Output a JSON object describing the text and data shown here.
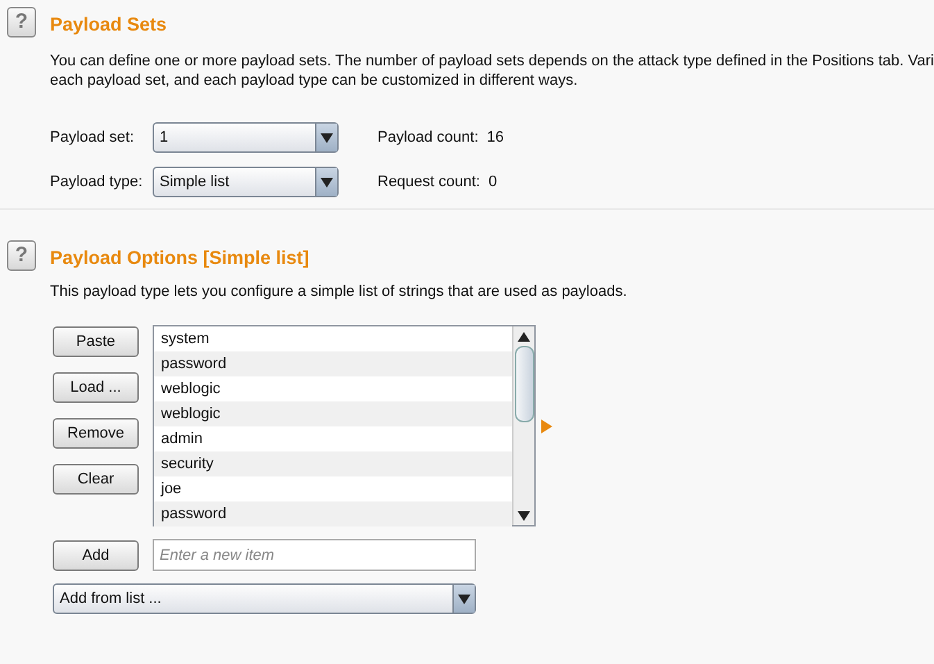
{
  "sections": [
    {
      "help_glyph": "?",
      "title": "Payload Sets",
      "description_lines": [
        "You can define one or more payload sets. The number of payload sets depends on the attack type defined in the Positions tab. Vari",
        "each payload set, and each payload type can be customized in different ways."
      ],
      "fields": [
        {
          "label": "Payload set:",
          "value": "1",
          "info_label": "Payload count:",
          "info_value": "16"
        },
        {
          "label": "Payload type:",
          "value": "Simple list",
          "info_label": "Request count:",
          "info_value": "0"
        }
      ]
    },
    {
      "help_glyph": "?",
      "title": "Payload Options [Simple list]",
      "description_lines": [
        "This payload type lets you configure a simple list of strings that are used as payloads."
      ],
      "buttons": [
        "Paste",
        "Load ...",
        "Remove",
        "Clear"
      ],
      "items": [
        "system",
        "password",
        "weblogic",
        "weblogic",
        "admin",
        "security",
        "joe",
        "password"
      ],
      "add_button": "Add",
      "add_field": {
        "placeholder": "Enter a new item"
      },
      "add_from_list": "Add from list ..."
    }
  ]
}
